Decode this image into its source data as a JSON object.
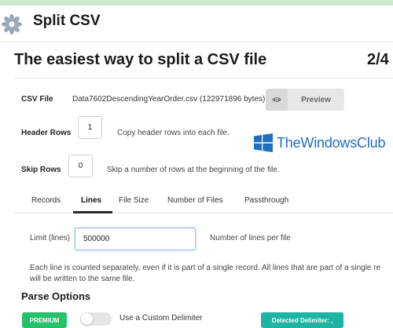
{
  "app": {
    "title": "Split CSV",
    "logo_icon": "gear-flower-icon"
  },
  "hero": {
    "headline": "The easiest way to split a CSV file",
    "step": "2/4"
  },
  "csv_file": {
    "label": "CSV File",
    "filename": "Data7602DescendingYearOrder.csv (122971896 bytes)",
    "preview_label": "Preview",
    "preview_icon": "eye-icon"
  },
  "header_rows": {
    "label": "Header Rows",
    "value": "1",
    "hint": "Copy header rows into each file."
  },
  "skip_rows": {
    "label": "Skip Rows",
    "value": "0",
    "hint": "Skip a number of rows at the beginning of the file."
  },
  "watermark": {
    "text": "TheWindowsClub",
    "icon": "windows-logo-icon",
    "color": "#1f6fc4"
  },
  "tabs": [
    {
      "label": "Records"
    },
    {
      "label": "Lines"
    },
    {
      "label": "File Size"
    },
    {
      "label": "Number of Files"
    },
    {
      "label": "Passthrough"
    }
  ],
  "active_tab": "Lines",
  "limit": {
    "label": "Limit (lines)",
    "value": "500000",
    "hint": "Number of lines per file"
  },
  "description": {
    "line1": "Each line is counted separately, even if it is part of a single record. All lines that are part of a single re",
    "line2": "will be written to the same file."
  },
  "parse_options": {
    "title": "Parse Options",
    "premium_label": "PREMIUM",
    "custom_delimiter_label": "Use a Custom Delimiter",
    "detected_label": "Detected Delimiter: ,"
  },
  "colors": {
    "premium": "#23c26b",
    "detected": "#1fb3a4",
    "top_strip": "#c9ead1"
  }
}
